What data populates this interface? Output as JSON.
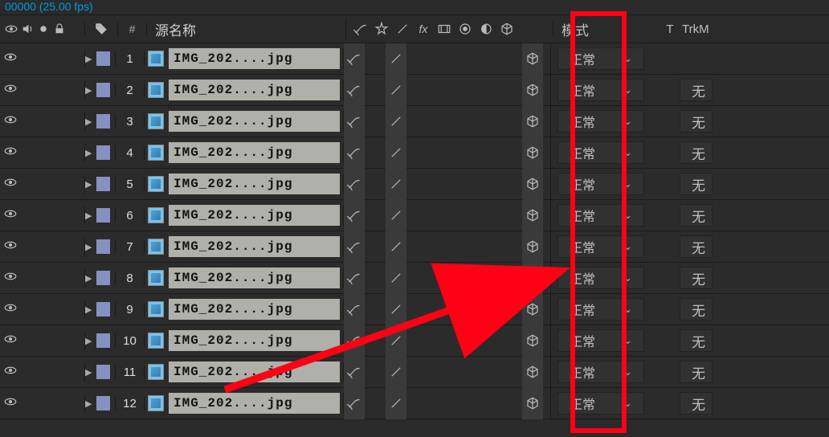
{
  "timecode": "00000 (25.00 fps)",
  "header": {
    "source_label": "源名称",
    "hash_label": "#",
    "mode_label": "模式",
    "t_label": "T",
    "trkm_label": "TrkM"
  },
  "mode_value": "正常",
  "track_matte_value": "无",
  "layer_label_color": "#8691c1",
  "highlight_color": "#ff0015",
  "layers": [
    {
      "num": "1",
      "name": "IMG_202....jpg",
      "has_track_matte": false
    },
    {
      "num": "2",
      "name": "IMG_202....jpg",
      "has_track_matte": true
    },
    {
      "num": "3",
      "name": "IMG_202....jpg",
      "has_track_matte": true
    },
    {
      "num": "4",
      "name": "IMG_202....jpg",
      "has_track_matte": true
    },
    {
      "num": "5",
      "name": "IMG_202....jpg",
      "has_track_matte": true
    },
    {
      "num": "6",
      "name": "IMG_202....jpg",
      "has_track_matte": true
    },
    {
      "num": "7",
      "name": "IMG_202....jpg",
      "has_track_matte": true
    },
    {
      "num": "8",
      "name": "IMG_202....jpg",
      "has_track_matte": true
    },
    {
      "num": "9",
      "name": "IMG_202....jpg",
      "has_track_matte": true
    },
    {
      "num": "10",
      "name": "IMG_202....jpg",
      "has_track_matte": true
    },
    {
      "num": "11",
      "name": "IMG_202....jpg",
      "has_track_matte": true
    },
    {
      "num": "12",
      "name": "IMG_202....jpg",
      "has_track_matte": true
    }
  ]
}
